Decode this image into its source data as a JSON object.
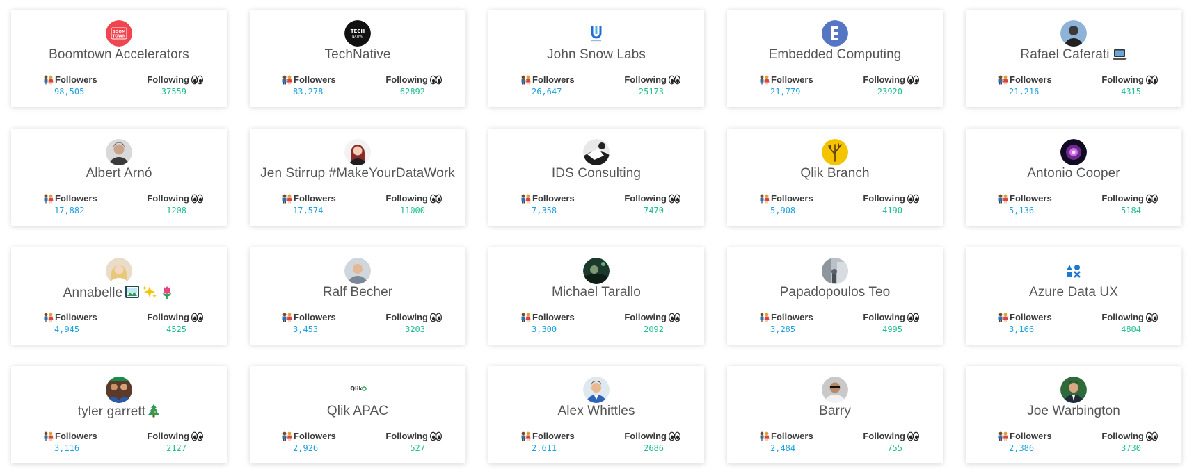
{
  "labels": {
    "followers": "Followers",
    "following": "Following"
  },
  "colors": {
    "followers_value": "#1ea1e0",
    "following_value": "#1fbf8f",
    "name": "#555555",
    "label": "#3a3a3a"
  },
  "icons": {
    "followers": "people-holding-hands-icon",
    "following": "eyes-icon"
  },
  "users": [
    {
      "name": "Boomtown Accelerators",
      "followers": "98,505",
      "following": "37559",
      "avatar": "boomtown-logo",
      "emoji": []
    },
    {
      "name": "TechNative",
      "followers": "83,278",
      "following": "62892",
      "avatar": "technative-logo",
      "emoji": []
    },
    {
      "name": "John Snow Labs",
      "followers": "26,647",
      "following": "25173",
      "avatar": "john-snow-labs-logo",
      "emoji": []
    },
    {
      "name": "Embedded Computing",
      "followers": "21,779",
      "following": "23920",
      "avatar": "embedded-computing-logo",
      "emoji": []
    },
    {
      "name": "Rafael Caferati",
      "followers": "21,216",
      "following": "4315",
      "avatar": "photo",
      "emoji": [
        "laptop-emoji"
      ]
    },
    {
      "name": "Albert Arnó",
      "followers": "17,882",
      "following": "1208",
      "avatar": "photo",
      "emoji": []
    },
    {
      "name": "Jen Stirrup #MakeYourDataWork",
      "followers": "17,574",
      "following": "11000",
      "avatar": "photo",
      "emoji": []
    },
    {
      "name": "IDS Consulting",
      "followers": "7,358",
      "following": "7470",
      "avatar": "photo",
      "emoji": []
    },
    {
      "name": "Qlik Branch",
      "followers": "5,908",
      "following": "4190",
      "avatar": "tree-logo",
      "emoji": []
    },
    {
      "name": "Antonio Cooper",
      "followers": "5,136",
      "following": "5184",
      "avatar": "photo",
      "emoji": []
    },
    {
      "name": "Annabelle",
      "followers": "4,945",
      "following": "4525",
      "avatar": "photo",
      "emoji": [
        "framed-picture-emoji",
        "sparkles-emoji",
        "tulip-emoji"
      ]
    },
    {
      "name": "Ralf Becher",
      "followers": "3,453",
      "following": "3203",
      "avatar": "photo",
      "emoji": []
    },
    {
      "name": "Michael Tarallo",
      "followers": "3,300",
      "following": "2092",
      "avatar": "photo",
      "emoji": []
    },
    {
      "name": "Papadopoulos Teo",
      "followers": "3,285",
      "following": "4995",
      "avatar": "photo",
      "emoji": []
    },
    {
      "name": "Azure Data UX",
      "followers": "3,166",
      "following": "4804",
      "avatar": "azure-data-ux-logo",
      "emoji": []
    },
    {
      "name": "tyler garrett",
      "followers": "3,116",
      "following": "2127",
      "avatar": "photo",
      "emoji": [
        "christmas-tree-emoji"
      ]
    },
    {
      "name": "Qlik APAC",
      "followers": "2,926",
      "following": "527",
      "avatar": "qlik-logo",
      "emoji": []
    },
    {
      "name": "Alex Whittles",
      "followers": "2,611",
      "following": "2686",
      "avatar": "photo",
      "emoji": []
    },
    {
      "name": "Barry",
      "followers": "2,484",
      "following": "755",
      "avatar": "photo",
      "emoji": []
    },
    {
      "name": "Joe Warbington",
      "followers": "2,386",
      "following": "3730",
      "avatar": "photo",
      "emoji": []
    }
  ],
  "avatar_text": {
    "boomtown": [
      "BOOM",
      "TOWN"
    ],
    "technative": [
      "TECH",
      "NATIVE"
    ],
    "qlik": "Qlik"
  }
}
